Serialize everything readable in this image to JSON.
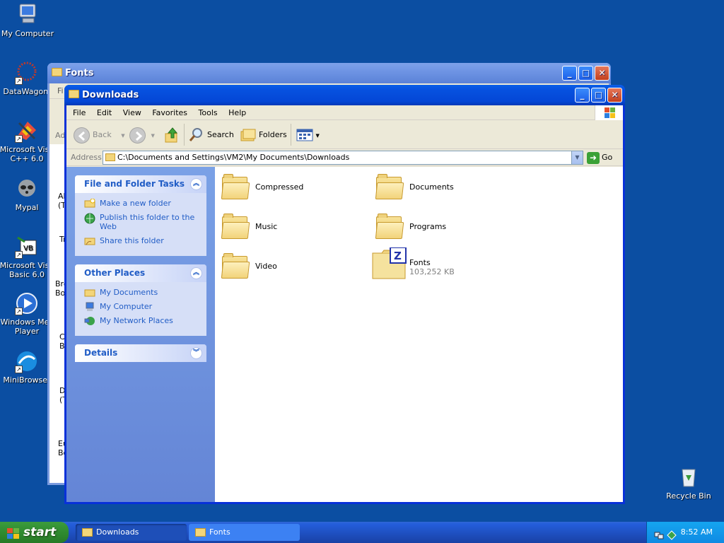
{
  "desktop": {
    "icons": [
      {
        "label": "My Computer"
      },
      {
        "label": "DataWagon."
      },
      {
        "label": "Microsoft Visu C++ 6.0"
      },
      {
        "label": "Mypal"
      },
      {
        "label": "Microsoft Visu Basic 6.0"
      },
      {
        "label": "Windows Mec Player"
      },
      {
        "label": "MiniBrowser"
      },
      {
        "label": "Recycle Bin"
      }
    ]
  },
  "background_window": {
    "title": "Fonts",
    "partial_text": [
      "Fi",
      "Ad",
      "Ah (T",
      "Tr",
      "Bro Bol",
      "Co Bo",
      "D (T",
      "Eu Bo"
    ]
  },
  "window": {
    "title": "Downloads",
    "menu": [
      "File",
      "Edit",
      "View",
      "Favorites",
      "Tools",
      "Help"
    ],
    "toolbar": {
      "back": "Back",
      "search": "Search",
      "folders": "Folders"
    },
    "address": {
      "label": "Address",
      "value": "C:\\Documents and Settings\\VM2\\My Documents\\Downloads",
      "go": "Go"
    },
    "tasks": {
      "file_folder": {
        "title": "File and Folder Tasks",
        "items": [
          "Make a new folder",
          "Publish this folder to the Web",
          "Share this folder"
        ]
      },
      "other_places": {
        "title": "Other Places",
        "items": [
          "My Documents",
          "My Computer",
          "My Network Places"
        ]
      },
      "details": {
        "title": "Details"
      }
    },
    "files": [
      {
        "name": "Compressed"
      },
      {
        "name": "Documents"
      },
      {
        "name": "Music"
      },
      {
        "name": "Programs"
      },
      {
        "name": "Video"
      },
      {
        "name": "Fonts",
        "size": "103,252 KB"
      }
    ]
  },
  "taskbar": {
    "start": "start",
    "buttons": [
      {
        "label": "Downloads",
        "active": true
      },
      {
        "label": "Fonts",
        "active": false
      }
    ],
    "clock": "8:52 AM"
  }
}
